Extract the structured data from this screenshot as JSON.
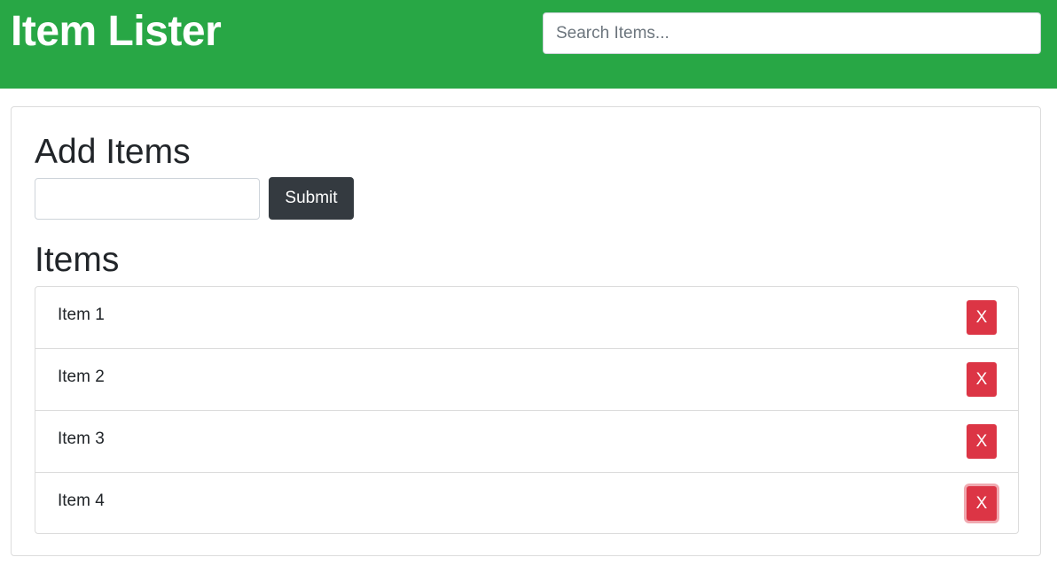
{
  "header": {
    "title": "Item Lister",
    "search_placeholder": "Search Items...",
    "background_color": "#28a745"
  },
  "add_section": {
    "heading": "Add Items",
    "input_value": "",
    "submit_label": "Submit"
  },
  "items_section": {
    "heading": "Items",
    "items": [
      {
        "label": "Item 1",
        "delete_label": "X"
      },
      {
        "label": "Item 2",
        "delete_label": "X"
      },
      {
        "label": "Item 3",
        "delete_label": "X"
      },
      {
        "label": "Item 4",
        "delete_label": "X"
      }
    ]
  },
  "colors": {
    "delete": "#dc3545",
    "submit": "#343a40"
  }
}
